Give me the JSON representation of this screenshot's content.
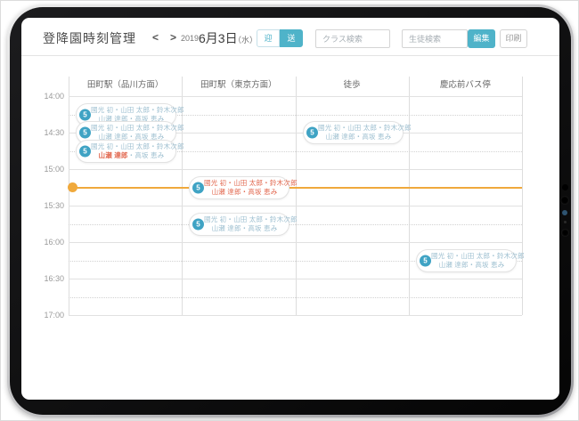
{
  "colors": {
    "accent": "#4fb3c9",
    "badge": "#3fa3c4",
    "orange": "#e2674e",
    "amber": "#f0a93c"
  },
  "header": {
    "title": "登降園時刻管理",
    "prev_label": "<",
    "next_label": ">",
    "date": {
      "year": "2019",
      "day": "6月3日",
      "weekday": "（水）"
    },
    "toggle": {
      "options": [
        {
          "label": "迎",
          "selected": false
        },
        {
          "label": "送",
          "selected": true
        }
      ]
    },
    "class_search_placeholder": "クラス検索",
    "student_search_placeholder": "生徒検索",
    "edit_label": "編集",
    "print_label": "印刷"
  },
  "schedule": {
    "columns": [
      "田町駅（品川方面）",
      "田町駅（東京方面）",
      "徒歩",
      "慶応前バス停"
    ],
    "times": [
      "14:00",
      "14:30",
      "15:00",
      "15:30",
      "16:00",
      "16:30",
      "17:00"
    ],
    "current_time_indicator": {
      "time": "15:15"
    },
    "events": [
      {
        "column": 0,
        "time": "14:15",
        "badge": "5",
        "variant": "normal",
        "line1": "國光 初・山田 太郎・鈴木次郎",
        "line2_parts": [
          {
            "text": "山瀬 達郎・高坂 恵み",
            "highlight": false
          }
        ]
      },
      {
        "column": 0,
        "time": "14:30",
        "badge": "5",
        "variant": "normal",
        "line1": "國光 初・山田 太郎・鈴木次郎",
        "line2_parts": [
          {
            "text": "山瀬 達郎・高坂 恵み",
            "highlight": false
          }
        ]
      },
      {
        "column": 0,
        "time": "14:45",
        "badge": "5",
        "variant": "normal",
        "line1": "國光 初・山田 太郎・鈴木次郎",
        "line2_parts": [
          {
            "text": "山瀬 達郎",
            "highlight": true
          },
          {
            "text": "・高坂 恵み",
            "highlight": false
          }
        ]
      },
      {
        "column": 2,
        "time": "14:30",
        "badge": "5",
        "variant": "normal",
        "line1": "國光 初・山田 太郎・鈴木次郎",
        "line2_parts": [
          {
            "text": "山瀬 達郎・高坂 恵み",
            "highlight": false
          }
        ]
      },
      {
        "column": 1,
        "time": "15:15",
        "badge": "5",
        "variant": "orange",
        "line1": "國光 初・山田 太郎・鈴木次郎",
        "line2_parts": [
          {
            "text": "山瀬 達郎・高坂 恵み",
            "highlight": false
          }
        ]
      },
      {
        "column": 1,
        "time": "15:45",
        "badge": "5",
        "variant": "normal",
        "line1": "國光 初・山田 太郎・鈴木次郎",
        "line2_parts": [
          {
            "text": "山瀬 達郎・高坂 恵み",
            "highlight": false
          }
        ]
      },
      {
        "column": 3,
        "time": "16:15",
        "badge": "5",
        "variant": "normal",
        "line1": "國光 初・山田 太郎・鈴木次郎",
        "line2_parts": [
          {
            "text": "山瀬 達郎・高坂 恵み",
            "highlight": false
          }
        ]
      }
    ]
  }
}
